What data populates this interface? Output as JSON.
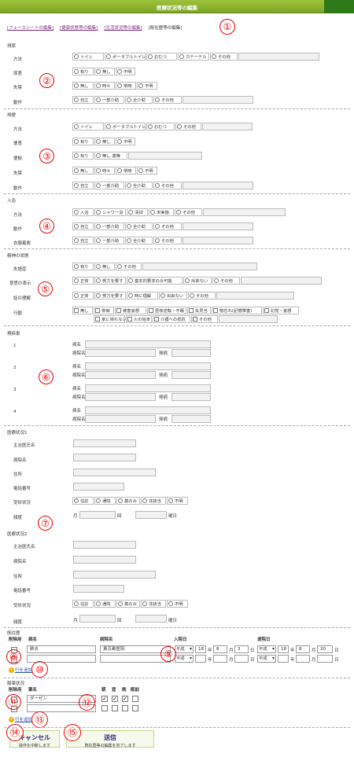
{
  "title": "医療状況等の編集",
  "tabs": {
    "t1": "[フェースシートの編集]",
    "t2": "[健康状態等の編集]",
    "t3": "[生活状況等の編集]",
    "t4": "[既往歴等の編集]"
  },
  "anno": {
    "a1": "①",
    "a2": "②",
    "a3": "③",
    "a4": "④",
    "a5": "⑤",
    "a6": "⑥",
    "a7": "⑦",
    "a8": "⑧",
    "a9": "⑨",
    "a10": "⑩",
    "a11": "⑪",
    "a12": "⑫",
    "a13": "⑬",
    "a14": "⑭",
    "a15": "⑮"
  },
  "excretion": {
    "title": "排尿",
    "method": "方法",
    "urge": "尿意",
    "incontinence": "失禁",
    "action": "動作"
  },
  "bowel": {
    "title": "排便",
    "method": "方法",
    "urge": "便意",
    "constipation": "便秘",
    "incontinence": "失禁",
    "action": "動作"
  },
  "bath": {
    "title": "入浴",
    "method": "方法",
    "action": "動作",
    "dress": "衣服着脱"
  },
  "mental": {
    "title": "精神の状態",
    "disorient": "失語症",
    "expression": "意思の表示",
    "understanding": "話の理解",
    "behavior": "行動"
  },
  "opts": {
    "toilet": "トイレ",
    "portable": "ポータブルトイレ",
    "diaper": "おむつ",
    "catheter": "カテーテル",
    "other": "その他",
    "yes": "有り",
    "no": "無し",
    "unknown": "不明",
    "sometimes": "時々",
    "always": "常時",
    "independent": "自立",
    "partial": "一部介助",
    "full": "全介助",
    "laxative": "有り",
    "nolax": "無し",
    "laxname": "薬等",
    "bathing": "入浴",
    "shower": "シャワー浴",
    "wipe": "清拭",
    "notdone": "未実施",
    "normal": "正常",
    "effort": "努力を要す",
    "basic": "基本的要求のみ可能",
    "cannot": "出来ない",
    "sometimesU": "時に理解",
    "b1": "無し",
    "b2": "徘徊",
    "b3": "被害妄想",
    "b4": "昼夜逆転・不眠",
    "b5": "失見当",
    "b6": "物忘れ(記憶障害)",
    "b7": "幻覚・妄想",
    "b8": "家に帰れない",
    "b9": "火の始末",
    "b10": "介護への抵抗",
    "b11": "その他"
  },
  "illness": {
    "title": "現疾患",
    "n1": "1",
    "n2": "2",
    "n3": "3",
    "n4": "4",
    "name": "病名",
    "hospital": "病院名",
    "onset": "発病"
  },
  "medical1": {
    "title": "医療状況1",
    "doctor": "主治医氏名",
    "hospital": "病院名",
    "address": "住所",
    "phone": "電話番号",
    "status": "受診状況",
    "freq": "頻度",
    "month": "月",
    "times": "回",
    "weekday": "曜日",
    "s1": "往診",
    "s2": "通院",
    "s3": "薬のみ",
    "s4": "非該当",
    "s5": "不明"
  },
  "medical2": {
    "title": "医療状況2"
  },
  "history": {
    "title": "既往歴",
    "h_del": "削除用",
    "h_name": "病名",
    "h_hosp": "病院名",
    "h_in": "入院日",
    "h_out": "退院日",
    "r1_name": "肺炎",
    "r1_hosp": "東京都医院",
    "era": "平成",
    "r1_in_y": "18",
    "r1_in_m": "8",
    "r1_in_d": "3",
    "r1_out_y": "18",
    "r1_out_m": "8",
    "r1_out_d": "20",
    "y": "年",
    "m": "月",
    "d": "日",
    "add": "行を追加"
  },
  "meds": {
    "title": "服薬状況",
    "h_del": "削除用",
    "h_name": "薬名",
    "morning": "朝",
    "noon": "昼",
    "evening": "晩",
    "sleep": "眠前",
    "r1_name": "ダーゼン",
    "check": "✓",
    "add": "行を追加"
  },
  "buttons": {
    "cancel": "キャンセル",
    "cancel_sub": "操作を中断します",
    "submit": "送信",
    "submit_sub": "既往歴等の編集を完了します"
  }
}
